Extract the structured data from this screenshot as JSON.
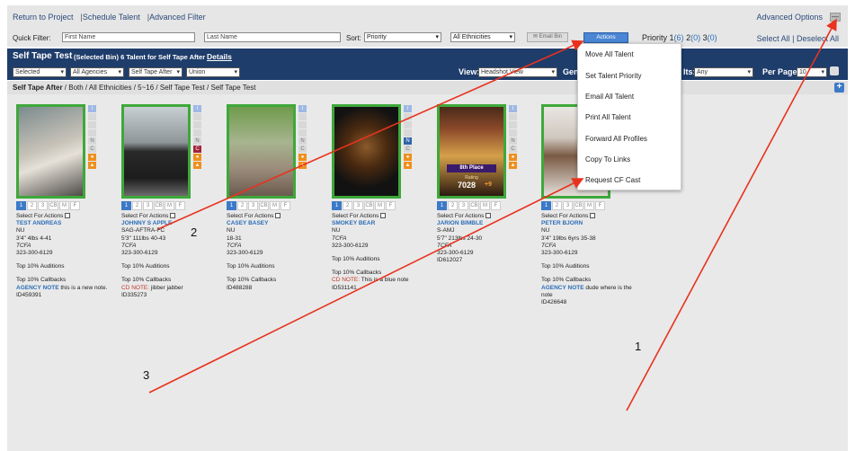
{
  "nav": {
    "return_link": "Return to Project",
    "schedule_link": "Schedule Talent",
    "advanced_filter": "Advanced Filter",
    "advanced_options": "Advanced Options",
    "minimize": "—"
  },
  "filter": {
    "quick_filter_label": "Quick Filter:",
    "first_name_placeholder": "First Name",
    "last_name_placeholder": "Last Name",
    "sort_label": "Sort:",
    "sort_value": "Priority",
    "ethnicity_value": "All Ethnicities",
    "email_bin": "✉ Email Bin",
    "actions": "Actions",
    "priority_label": "Priority",
    "p1": "1",
    "p1c": "(6)",
    "p2": "2",
    "p2c": "(0)",
    "p3": "3",
    "p3c": "(0)",
    "select_all": "Select All",
    "deselect_all": "| Deselect All"
  },
  "bin": {
    "title": "Self Tape Test",
    "subtitle": "(Selected Bin) 6 Talent for Self Tape After",
    "details": "Details"
  },
  "filters2": {
    "selected": "Selected",
    "agencies": "All Agencies",
    "status": "Self Tape After",
    "union": "Union",
    "view_label": "View:",
    "view_value": "Headshot View",
    "gen_label": "Gen",
    "results_label": "lts:",
    "results_value": "Any",
    "per_page_label": "Per Page:",
    "per_page_value": "10"
  },
  "breadcrumb": {
    "bold": "Self Tape After",
    "rest": " / Both / All Ethnicities / 5~16 / Self Tape Test / Self Tape Test"
  },
  "cards": [
    {
      "select": "Select For Actions",
      "name": "TEST ANDREAS",
      "union": "NU",
      "stats": "3'4\" 4lbs 4-41",
      "agency": "TCFA",
      "phone": "323-300-6129",
      "aud": "Top 10% Auditions",
      "call": "Top 10% Callbacks",
      "note_label": "AGENCY NOTE",
      "note": " this is a new note.",
      "id": "ID459391"
    },
    {
      "select": "Select For Actions",
      "name": "JOHNNY S APPLE",
      "union": "SAG-AFTRA-FC",
      "stats": "5'3\" 111lbs 40-43",
      "agency": "TCFA",
      "phone": "323-300-6129",
      "aud": "Top 10% Auditions",
      "call": "Top 10% Callbacks",
      "note_label": "CD NOTE:",
      "note": " jibber jabber",
      "id": "ID335273"
    },
    {
      "select": "Select For Actions",
      "name": "CASEY BASEY",
      "union": "NU",
      "stats": "18-31",
      "agency": "TCFA",
      "phone": "323-300-6129",
      "aud": "Top 10% Auditions",
      "call": "Top 10% Callbacks",
      "note_label": "",
      "note": "",
      "id": "ID488288"
    },
    {
      "select": "Select For Actions",
      "name": "SMOKEY BEAR",
      "union": "NU",
      "stats": "",
      "agency": "TCFA",
      "phone": "323-300-6129",
      "aud": "Top 10% Auditions",
      "call": "Top 10% Callbacks",
      "note_label": "CD NOTE:",
      "note": " This is a blue note",
      "id": "ID531141"
    },
    {
      "select": "Select For Actions",
      "name": "JARION BIMBLE",
      "union": "S-AMJ",
      "stats": "5'7\" 213lbs 24-30",
      "agency": "TCFA",
      "phone": "323-300-6129",
      "aud": "",
      "call": "",
      "note_label": "",
      "note": "",
      "id": "ID612027"
    },
    {
      "select": "Select For Actions",
      "name": "PETER BJORN",
      "union": "NU",
      "stats": "3'4\" 19lbs 6yrs 35-38",
      "agency": "TCFA",
      "phone": "323-300-6129",
      "aud": "Top 10% Auditions",
      "call": "Top 10% Callbacks",
      "note_label": "AGENCY NOTE",
      "note": " dude where is the note",
      "id": "ID426648"
    }
  ],
  "tabs": [
    "1",
    "2",
    "3",
    "CB",
    "M",
    "F"
  ],
  "side_icons": [
    "i",
    "",
    "",
    "",
    "N",
    "C",
    "",
    ""
  ],
  "game_card": {
    "place": "8th Place",
    "rating_label": "Rating",
    "rating": "7028",
    "delta": "+9"
  },
  "dropdown": [
    "Move All Talent",
    "Set Talent Priority",
    "Email All Talent",
    "Print All Talent",
    "Forward All Profiles",
    "Copy To Links",
    "Request CF Cast"
  ],
  "annotations": {
    "one": "1",
    "two": "2",
    "three": "3"
  },
  "colors": {
    "accent": "#1e3d6b",
    "green_border": "#3ea83a",
    "arrow": "#e8321e",
    "link": "#2b6db8"
  }
}
